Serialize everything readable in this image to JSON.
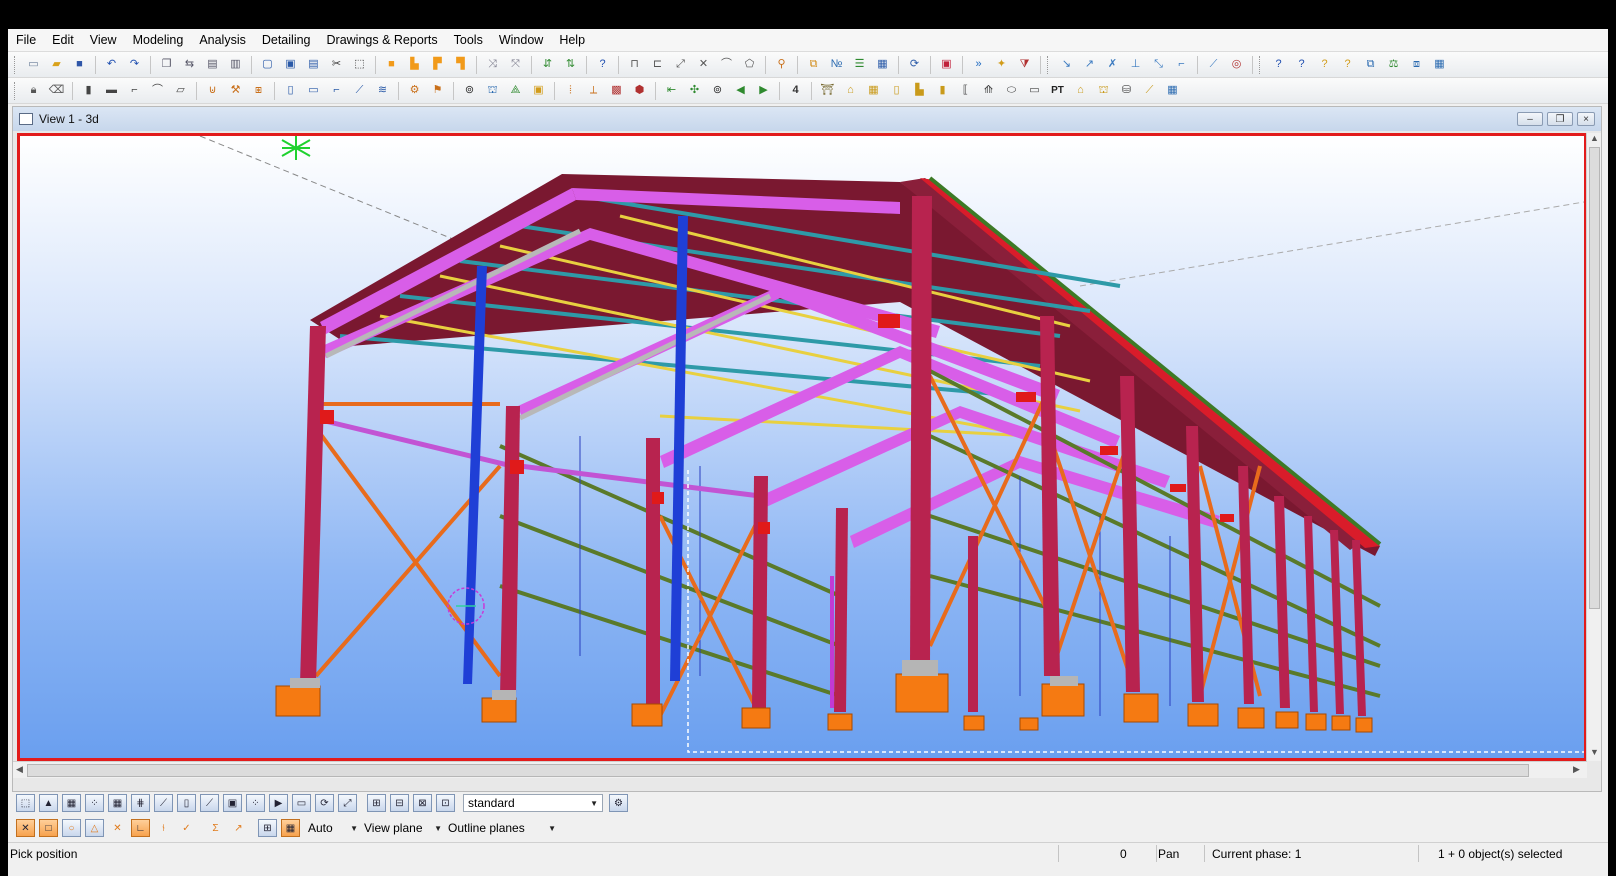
{
  "menu": [
    "File",
    "Edit",
    "View",
    "Modeling",
    "Analysis",
    "Detailing",
    "Drawings & Reports",
    "Tools",
    "Window",
    "Help"
  ],
  "view": {
    "title": "View 1 - 3d"
  },
  "bottom_toolbar": {
    "filter_value": "standard",
    "snap_mode": "Auto",
    "plane_mode": "View plane",
    "outline_mode": "Outline planes"
  },
  "status": {
    "prompt": "Pick position",
    "count": "0",
    "mode": "Pan",
    "phase": "Current phase: 1",
    "selection": "1 + 0 object(s) selected"
  },
  "colors": {
    "frame_border": "#e21b1b",
    "steel_column": "#b8234f",
    "rafter_purlin_pink": "#d85ee8",
    "bracing_orange": "#e86b1c",
    "roof_deck": "#7a1830",
    "girt_green": "#5a7a2a",
    "purlin_teal": "#2e9aa8",
    "purlin_yellow": "#e8d040",
    "wind_column_blue": "#1f3fd6",
    "footing_orange": "#f57a12"
  }
}
